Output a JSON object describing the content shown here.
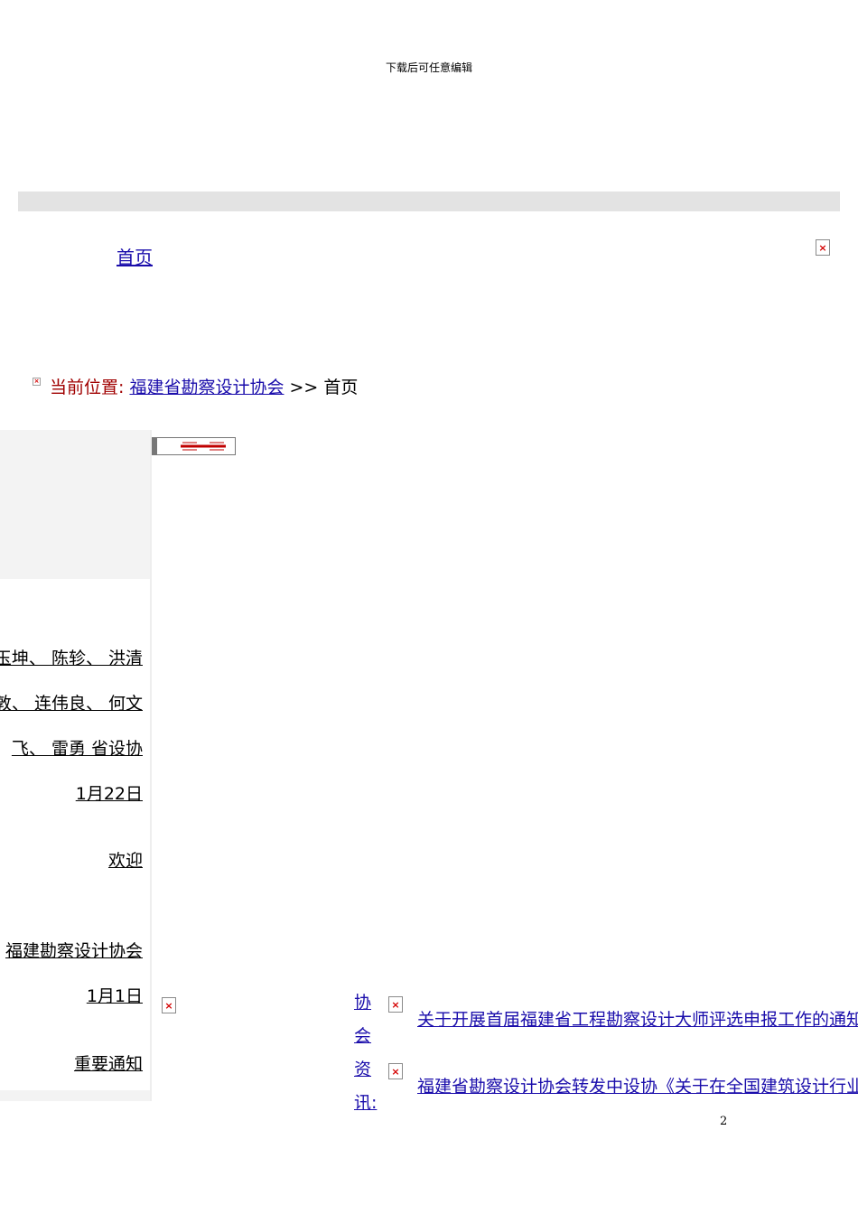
{
  "header_note": "下载后可任意编辑",
  "nav": {
    "home": "首页"
  },
  "breadcrumb": {
    "label": "当前位置:",
    "org": "福建省勘察设计协会",
    "sep": ">>",
    "current": "首页"
  },
  "sidebar": {
    "lines": [
      "玉坤、 陈轸、 洪清",
      "敦、 连伟良、 何文",
      "飞、 雷勇 省设协",
      "1月22日",
      "欢迎",
      "福建勘察设计协会",
      "1月1日",
      "重要通知"
    ]
  },
  "section": {
    "label_chars": [
      "协",
      "会",
      "资",
      "讯:"
    ]
  },
  "news": [
    "关于开展首届福建省工程勘察设计大师评选申报工作的通知",
    "福建省勘察设计协会转发中设协《关于在全国建筑设计行业"
  ],
  "page_number": "2",
  "colors": {
    "link": "#1a0dab",
    "label_red": "#a00000",
    "bar_gray": "#e3e3e3"
  }
}
